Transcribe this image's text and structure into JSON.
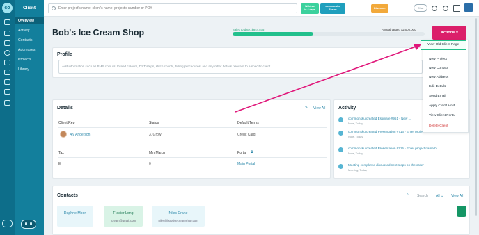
{
  "sidebar": {
    "title": "Client",
    "items": [
      {
        "label": "Overview"
      },
      {
        "label": "Activity"
      },
      {
        "label": "Contacts"
      },
      {
        "label": "Addresses"
      },
      {
        "label": "Projects"
      },
      {
        "label": "Library"
      }
    ]
  },
  "topbar": {
    "search_placeholder": "Enter project's name, client's name, project's number or PO#",
    "webinar_line1": "Webinar",
    "webinar_line2": "in 4 days",
    "forum_line1": "commonsku",
    "forum_line2": "Forum",
    "discover_label": "Discover",
    "chat_label": "Chat"
  },
  "header": {
    "title": "Bob's Ice Cream Shop",
    "sales_label": "Sales to date: $844,875",
    "target_label": "Annual target: $2,000,000",
    "sales_progress": 0.42,
    "actions_label": "Actions"
  },
  "menu": {
    "items": [
      {
        "label": "View Old Client Page"
      },
      {
        "label": "New Project"
      },
      {
        "label": "New Contact"
      },
      {
        "label": "New Address"
      },
      {
        "label": "Edit Details"
      },
      {
        "label": "Send Email"
      },
      {
        "label": "Apply Credit Hold"
      },
      {
        "label": "View Client Portal"
      },
      {
        "label": "Delete Client"
      }
    ]
  },
  "profile": {
    "title": "Profile",
    "placeholder": "Add information such as PMS colours, thread colours, DST steps, stitch counts, billing procedures, and any other details relevant to a specific client."
  },
  "details": {
    "title": "Details",
    "view_all": "View All",
    "client_rep_label": "Client Rep",
    "client_rep_value": "Aly Anderson",
    "status_label": "Status",
    "status_value": "3. Grow",
    "terms_label": "Default Terms",
    "terms_value": "Credit Card",
    "tax_label": "Tax",
    "tax_value": "E",
    "margin_label": "Min Margin",
    "margin_value": "0",
    "portal_label": "Portal",
    "portal_value": "Main Portal"
  },
  "activity": {
    "title": "Activity",
    "items": [
      {
        "text": "commonsku created Estimate #951 - New ...",
        "meta": "Note, Today"
      },
      {
        "text": "commonsku created Presentation #716 - Enter project name h...",
        "meta": "Note, Today"
      },
      {
        "text": "commonsku created Presentation #715 - Enter project name h...",
        "meta": "Note, Today"
      },
      {
        "text": "Meeting completed discussed next steps on the order",
        "meta": "Meeting, Today"
      }
    ]
  },
  "contacts": {
    "title": "Contacts",
    "search_label": "Search",
    "filter_label": "All",
    "view_all": "View All",
    "items": [
      {
        "name": "Daphne Moon",
        "email": ""
      },
      {
        "name": "Frasier Long",
        "email": "icream@gmail.com"
      },
      {
        "name": "Niles Crane",
        "email": "niles@bobsicecreamshop.com"
      }
    ]
  },
  "colors": {
    "brand": "#137f9c",
    "accent": "#db1f6a",
    "success": "#22c08c"
  }
}
